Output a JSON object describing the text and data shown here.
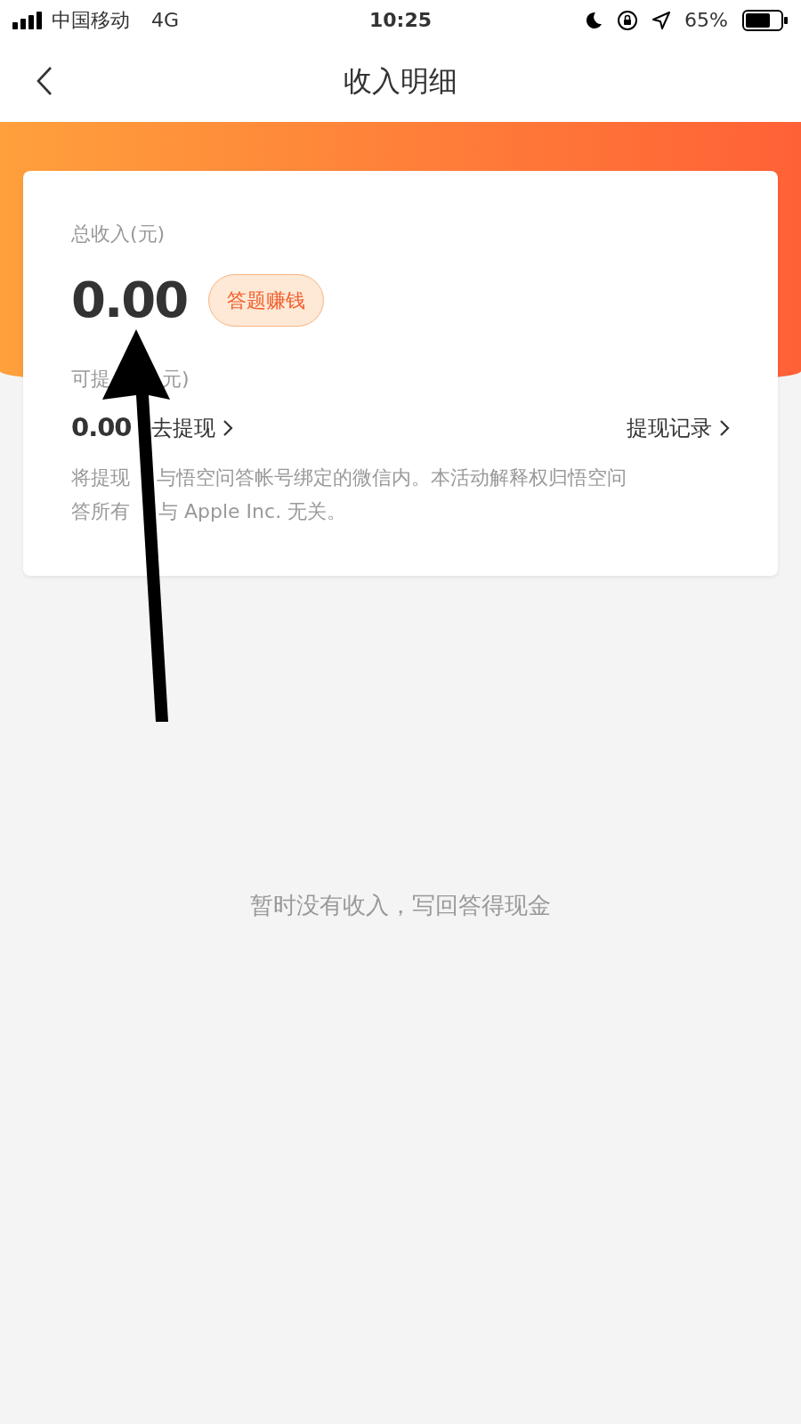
{
  "status_bar": {
    "carrier": "中国移动",
    "network": "4G",
    "time": "10:25",
    "battery": "65%"
  },
  "nav": {
    "title": "收入明细"
  },
  "summary": {
    "total_label": "总收入(元)",
    "total": "0.00",
    "earn_button": "答题赚钱",
    "withdrawable_label": [
      "可提",
      "元)"
    ],
    "withdrawable": "0.00",
    "withdraw_link": "去提现",
    "records_link": "提现记录",
    "note_lines": [
      [
        "将提现",
        "与悟空问答帐号绑定的微信内。本活动解释权归悟空问"
      ],
      [
        "答所有",
        "与 Apple Inc. 无关。"
      ]
    ]
  },
  "empty_message": "暂时没有收入，写回答得现金"
}
